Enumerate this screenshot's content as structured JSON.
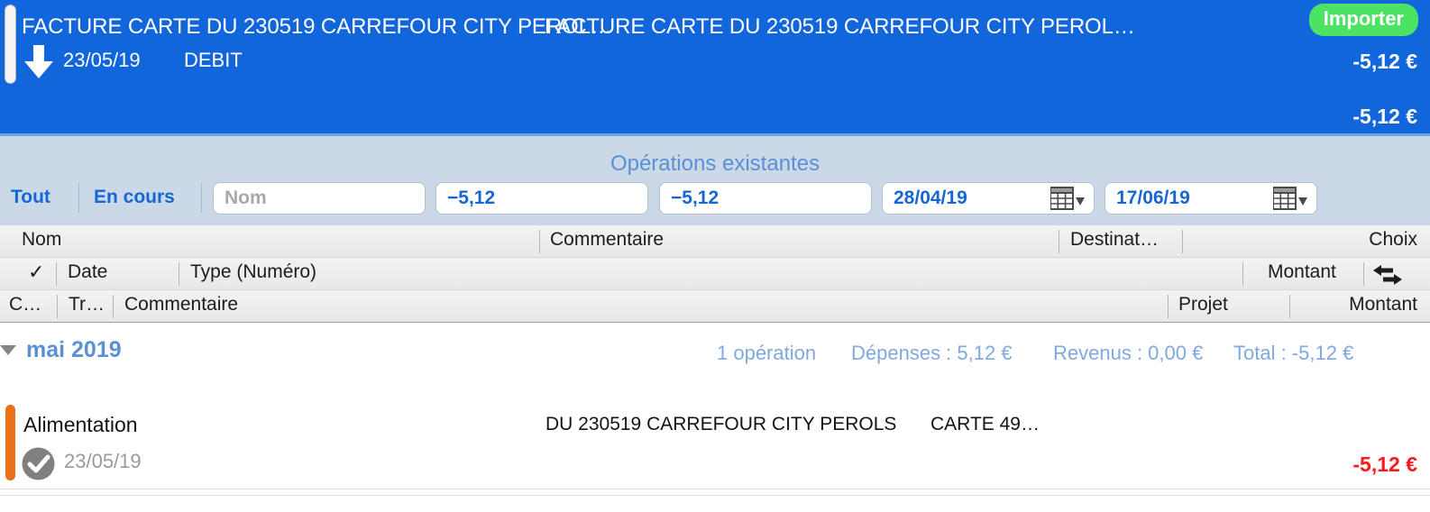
{
  "import_header": {
    "title_left": "FACTURE CARTE DU 230519 CARREFOUR CITY  PEROL…",
    "title_right": "FACTURE CARTE DU 230519 CARREFOUR CITY  PEROL…",
    "date": "23/05/19",
    "type": "DEBIT",
    "import_button": "Importer",
    "amount_row": "-5,12 €",
    "amount_total": "-5,12 €",
    "download_icon": "download-arrow-icon",
    "drag_handle_icon": "drag-handle-icon",
    "accent_color": "#1266dc",
    "import_button_color": "#4ce364"
  },
  "filter_bar": {
    "section_label": "Opérations existantes",
    "tabs": [
      {
        "label": "Tout"
      },
      {
        "label": "En cours"
      }
    ],
    "fields": {
      "name_placeholder": "Nom",
      "name_value": "",
      "amount_min": "−5,12",
      "amount_max": "−5,12",
      "date_from": "28/04/19",
      "date_to": "17/06/19"
    },
    "calendar_icon": "calendar-icon",
    "link_color": "#1667d3"
  },
  "column_headers": {
    "row1": {
      "nom": "Nom",
      "commentaire": "Commentaire",
      "destinataire": "Destinat…",
      "choix": "Choix"
    },
    "row2": {
      "check": "✓",
      "date": "Date",
      "type": "Type (Numéro)",
      "montant": "Montant",
      "sort_icon": "sort-left-right-icon"
    },
    "row3": {
      "c": "C…",
      "tr": "Tr…",
      "commentaire": "Commentaire",
      "projet": "Projet",
      "montant": "Montant"
    }
  },
  "month_group": {
    "label": "mai 2019",
    "disclosure_icon": "disclosure-triangle-down-icon",
    "operations_count": "1 opération",
    "depenses": "Dépenses : 5,12 €",
    "revenus": "Revenus : 0,00 €",
    "total": "Total : -5,12 €"
  },
  "transactions": [
    {
      "category": "Alimentation",
      "category_color": "#e8701b",
      "date": "23/05/19",
      "status_icon": "checkmark-circle-icon",
      "comment": "DU 230519 CARREFOUR CITY  PEROLS",
      "comment_extra": "CARTE  49…",
      "amount": "-5,12 €",
      "amount_color": "#fb1a22"
    }
  ]
}
